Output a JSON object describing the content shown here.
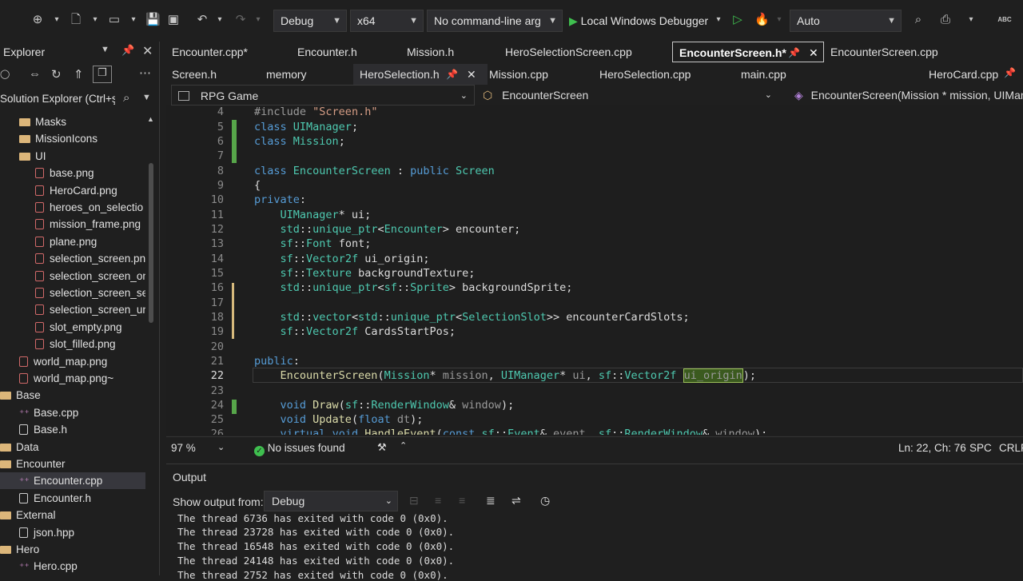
{
  "toolbar": {
    "config": "Debug",
    "platform": "x64",
    "cmdline": "No command-line arg",
    "debugger": "Local Windows Debugger",
    "auto": "Auto"
  },
  "solution_explorer": {
    "title": "Explorer",
    "search_placeholder": "Solution Explorer (Ctrl+ş",
    "items": [
      {
        "label": "Masks",
        "icon": "folder"
      },
      {
        "label": "MissionIcons",
        "icon": "folder"
      },
      {
        "label": "UI",
        "icon": "folder"
      },
      {
        "label": "base.png",
        "icon": "png"
      },
      {
        "label": "HeroCard.png",
        "icon": "png"
      },
      {
        "label": "heroes_on_selectio",
        "icon": "png"
      },
      {
        "label": "mission_frame.png",
        "icon": "png"
      },
      {
        "label": "plane.png",
        "icon": "png"
      },
      {
        "label": "selection_screen.png",
        "icon": "png"
      },
      {
        "label": "selection_screen_on",
        "icon": "png"
      },
      {
        "label": "selection_screen_sel",
        "icon": "png"
      },
      {
        "label": "selection_screen_un:",
        "icon": "png"
      },
      {
        "label": "slot_empty.png",
        "icon": "png"
      },
      {
        "label": "slot_filled.png",
        "icon": "png"
      },
      {
        "label": "world_map.png",
        "icon": "png"
      },
      {
        "label": "world_map.png~",
        "icon": "png"
      },
      {
        "label": "Base",
        "icon": "folder"
      },
      {
        "label": "Base.cpp",
        "icon": "cpp"
      },
      {
        "label": "Base.h",
        "icon": "h"
      },
      {
        "label": "Data",
        "icon": "folder"
      },
      {
        "label": "Encounter",
        "icon": "folder"
      },
      {
        "label": "Encounter.cpp",
        "icon": "cpp"
      },
      {
        "label": "Encounter.h",
        "icon": "h"
      },
      {
        "label": "External",
        "icon": "folder"
      },
      {
        "label": "json.hpp",
        "icon": "json"
      },
      {
        "label": "Hero",
        "icon": "folder"
      },
      {
        "label": "Hero.cpp",
        "icon": "cpp"
      }
    ]
  },
  "tabs_row1": [
    "Encounter.cpp*",
    "Encounter.h",
    "Mission.h",
    "HeroSelectionScreen.cpp",
    "EncounterScreen.h*",
    "EncounterScreen.cpp"
  ],
  "tabs_row2": [
    "Screen.h",
    "memory",
    "HeroSelection.h",
    "Mission.cpp",
    "HeroSelection.cpp",
    "main.cpp",
    "HeroCard.cpp"
  ],
  "navbar": {
    "project": "RPG Game",
    "scope": "EncounterScreen",
    "member": "EncounterScreen(Mission * mission, UIManag"
  },
  "editor": {
    "line_numbers": [
      "4",
      "5",
      "6",
      "7",
      "8",
      "9",
      "10",
      "11",
      "12",
      "13",
      "14",
      "15",
      "16",
      "17",
      "18",
      "19",
      "20",
      "21",
      "22",
      "23",
      "24",
      "25",
      "26"
    ]
  },
  "status": {
    "zoom": "97 %",
    "issues": "No issues found",
    "position": "Ln: 22, Ch: 76",
    "whitespace": "SPC",
    "line_ending": "CRLF"
  },
  "output": {
    "title": "Output",
    "show_from_label": "Show output from:",
    "source": "Debug",
    "lines": [
      "The thread 6736 has exited with code 0 (0x0).",
      "The thread 23728 has exited with code 0 (0x0).",
      "The thread 16548 has exited with code 0 (0x0).",
      "The thread 24148 has exited with code 0 (0x0).",
      "The thread 2752 has exited with code 0 (0x0)."
    ]
  }
}
